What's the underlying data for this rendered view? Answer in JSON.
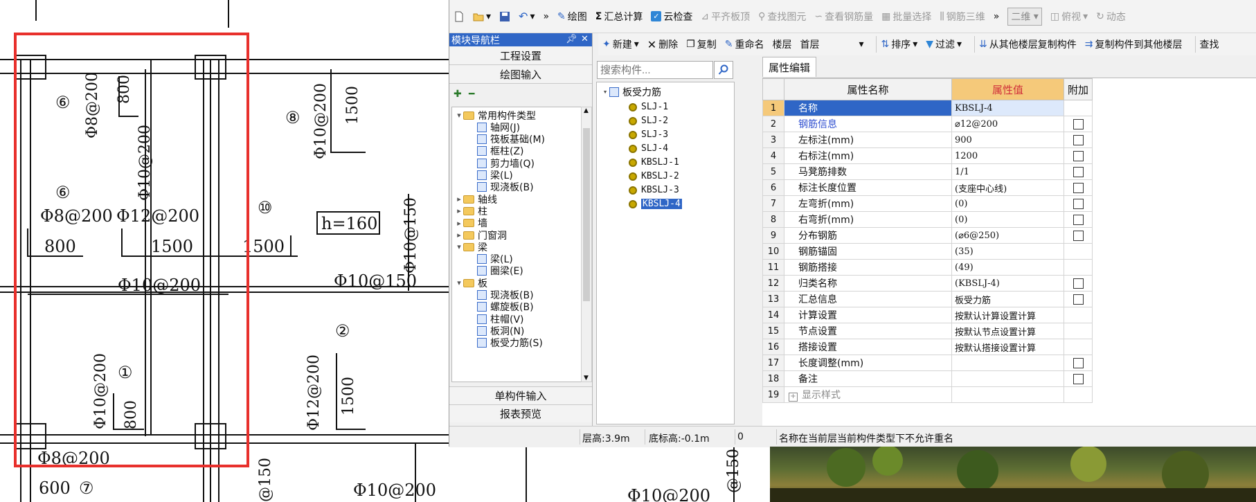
{
  "drawing": {
    "labels": {
      "c6a": "⑥",
      "c6b": "⑥",
      "c8": "⑧",
      "c10": "⑩",
      "c1": "①",
      "c2": "②",
      "c7": "⑦",
      "t1": "Φ8@200",
      "t2": "800",
      "t3": "Φ10@200",
      "t4": "Φ10@200",
      "t5": "1500",
      "t6": "Φ8@200",
      "t7": "Φ12@200",
      "t8": "800",
      "t9": "1500",
      "t10": "1500",
      "t11": "h=160",
      "t12": "Φ10@150",
      "t13": "Φ10@200",
      "t14": "Φ10@150",
      "t15": "Φ10@200",
      "t16": "800",
      "t17": "Φ12@200",
      "t18": "1500",
      "t19": "Φ8@200",
      "t20": "600",
      "t21": "Φ10@200",
      "t22": "Φ10@200",
      "t23": "@150",
      "t24": "@150"
    }
  },
  "toolbar1": {
    "draw": "绘图",
    "sum": "汇总计算",
    "cloud": "云检查",
    "flat": "平齐板顶",
    "find": "查找图元",
    "view_rebar": "查看钢筋量",
    "batch": "批量选择",
    "rebar3d": "钢筋三维",
    "view2d": "二维",
    "top_view": "俯视",
    "dyn": "动态"
  },
  "toolbar2": {
    "new": "新建",
    "delete": "删除",
    "copy": "复制",
    "rename": "重命名",
    "floor_label": "楼层",
    "floor_value": "首层",
    "sort": "排序",
    "filter": "过滤",
    "copy_from": "从其他楼层复制构件",
    "copy_to": "复制构件到其他楼层",
    "find": "查找"
  },
  "nav": {
    "title": "模块导航栏",
    "btn_project": "工程设置",
    "btn_draw": "绘图输入",
    "tree": [
      {
        "label": "常用构件类型",
        "type": "folder",
        "exp": "▾",
        "level": 0
      },
      {
        "label": "轴网(J)",
        "type": "item",
        "level": 1
      },
      {
        "label": "筏板基础(M)",
        "type": "item",
        "level": 1
      },
      {
        "label": "框柱(Z)",
        "type": "item",
        "level": 1
      },
      {
        "label": "剪力墙(Q)",
        "type": "item",
        "level": 1
      },
      {
        "label": "梁(L)",
        "type": "item",
        "level": 1
      },
      {
        "label": "现浇板(B)",
        "type": "item",
        "level": 1
      },
      {
        "label": "轴线",
        "type": "folder",
        "exp": "▸",
        "level": 0
      },
      {
        "label": "柱",
        "type": "folder",
        "exp": "▸",
        "level": 0
      },
      {
        "label": "墙",
        "type": "folder",
        "exp": "▸",
        "level": 0
      },
      {
        "label": "门窗洞",
        "type": "folder",
        "exp": "▸",
        "level": 0
      },
      {
        "label": "梁",
        "type": "folder",
        "exp": "▾",
        "level": 0
      },
      {
        "label": "梁(L)",
        "type": "item",
        "level": 1
      },
      {
        "label": "圈梁(E)",
        "type": "item",
        "level": 1
      },
      {
        "label": "板",
        "type": "folder",
        "exp": "▾",
        "level": 0
      },
      {
        "label": "现浇板(B)",
        "type": "item",
        "level": 1
      },
      {
        "label": "螺旋板(B)",
        "type": "item",
        "level": 1
      },
      {
        "label": "柱帽(V)",
        "type": "item",
        "level": 1
      },
      {
        "label": "板洞(N)",
        "type": "item",
        "level": 1
      },
      {
        "label": "板受力筋(S)",
        "type": "item",
        "level": 1
      }
    ],
    "btn_single": "单构件输入",
    "btn_report": "报表预览"
  },
  "list": {
    "search_placeholder": "搜索构件...",
    "root": "板受力筋",
    "items": [
      "SLJ-1",
      "SLJ-2",
      "SLJ-3",
      "SLJ-4",
      "KBSLJ-1",
      "KBSLJ-2",
      "KBSLJ-3",
      "KBSLJ-4"
    ],
    "selected": "KBSLJ-4"
  },
  "props": {
    "tab": "属性编辑",
    "headers": {
      "name": "属性名称",
      "value": "属性值",
      "extra": "附加"
    },
    "rows": [
      {
        "n": "1",
        "name": "名称",
        "value": "KBSLJ-4",
        "cb": false
      },
      {
        "n": "2",
        "name": "钢筋信息",
        "value": "⌀12@200",
        "cb": true
      },
      {
        "n": "3",
        "name": "左标注(mm)",
        "value": "900",
        "cb": true
      },
      {
        "n": "4",
        "name": "右标注(mm)",
        "value": "1200",
        "cb": true
      },
      {
        "n": "5",
        "name": "马凳筋排数",
        "value": "1/1",
        "cb": true
      },
      {
        "n": "6",
        "name": "标注长度位置",
        "value": "(支座中心线)",
        "cb": true
      },
      {
        "n": "7",
        "name": "左弯折(mm)",
        "value": "(0)",
        "cb": true
      },
      {
        "n": "8",
        "name": "右弯折(mm)",
        "value": "(0)",
        "cb": true
      },
      {
        "n": "9",
        "name": "分布钢筋",
        "value": "(⌀6@250)",
        "cb": true
      },
      {
        "n": "10",
        "name": "钢筋锚固",
        "value": "(35)",
        "cb": false
      },
      {
        "n": "11",
        "name": "钢筋搭接",
        "value": "(49)",
        "cb": false
      },
      {
        "n": "12",
        "name": "归类名称",
        "value": "(KBSLJ-4)",
        "cb": true
      },
      {
        "n": "13",
        "name": "汇总信息",
        "value": "板受力筋",
        "cb": true
      },
      {
        "n": "14",
        "name": "计算设置",
        "value": "按默认计算设置计算",
        "cb": false
      },
      {
        "n": "15",
        "name": "节点设置",
        "value": "按默认节点设置计算",
        "cb": false
      },
      {
        "n": "16",
        "name": "搭接设置",
        "value": "按默认搭接设置计算",
        "cb": false
      },
      {
        "n": "17",
        "name": "长度调整(mm)",
        "value": "",
        "cb": true
      },
      {
        "n": "18",
        "name": "备注",
        "value": "",
        "cb": true
      },
      {
        "n": "19",
        "name": "显示样式",
        "value": "",
        "cb": false
      }
    ]
  },
  "status": {
    "floor_height": "层高:3.9m",
    "bottom_elev": "底标高:-0.1m",
    "zero": "0",
    "message": "名称在当前层当前构件类型下不允许重名"
  },
  "colors": {
    "accent": "#2f66c6",
    "highlight": "#e8302c",
    "header_orange": "#f5c97a"
  }
}
